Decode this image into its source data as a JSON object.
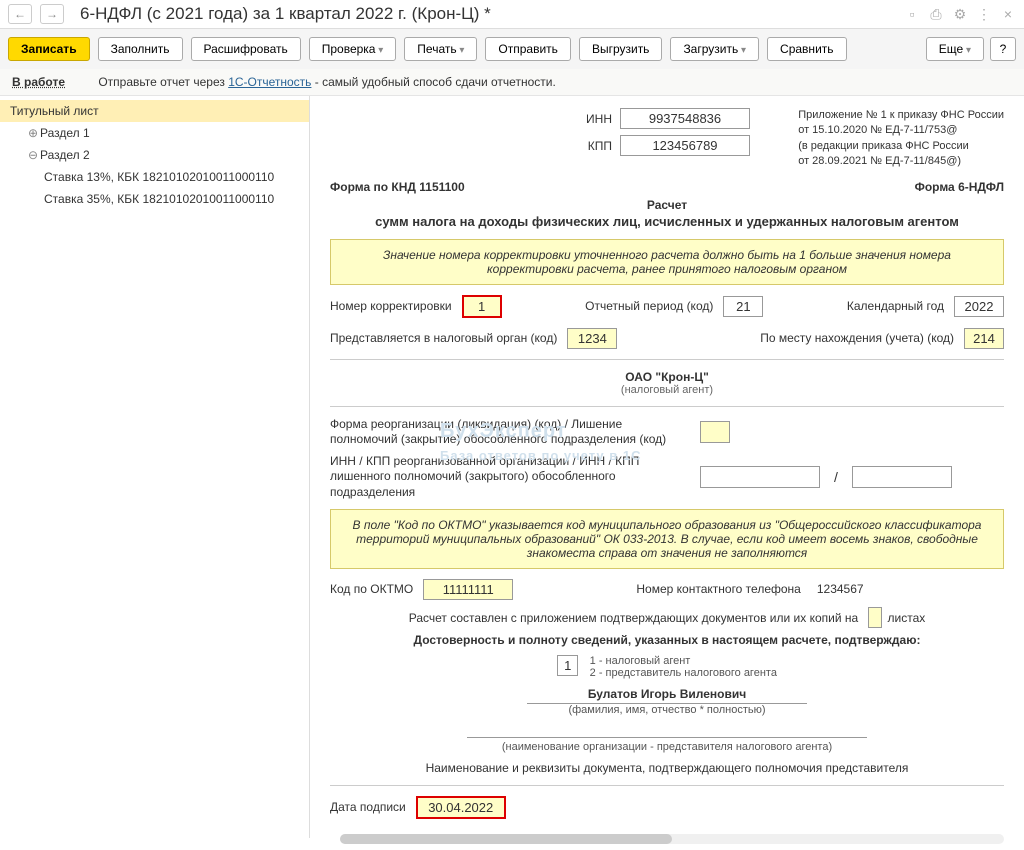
{
  "header": {
    "title": "6-НДФЛ (с 2021 года) за 1 квартал 2022 г. (Крон-Ц) *"
  },
  "toolbar": {
    "record": "Записать",
    "fill": "Заполнить",
    "decode": "Расшифровать",
    "check": "Проверка",
    "print": "Печать",
    "send": "Отправить",
    "export": "Выгрузить",
    "import": "Загрузить",
    "compare": "Сравнить",
    "more": "Еще",
    "help": "?"
  },
  "infobar": {
    "status": "В работе",
    "text1": "Отправьте отчет через ",
    "link": "1С-Отчетность",
    "text2": " - самый удобный способ сдачи отчетности."
  },
  "tree": {
    "title_page": "Титульный лист",
    "section1": "Раздел 1",
    "section2": "Раздел 2",
    "rate13": "Ставка 13%, КБК 18210102010011000110",
    "rate35": "Ставка 35%, КБК 18210102010011000110"
  },
  "form": {
    "inn_l": "ИНН",
    "inn_v": "9937548836",
    "kpp_l": "КПП",
    "kpp_v": "123456789",
    "annex1": "Приложение № 1 к приказу ФНС России",
    "annex2": "от 15.10.2020 № ЕД-7-11/753@",
    "annex3": "(в редакции приказа ФНС России",
    "annex4": "от 28.09.2021 № ЕД-7-11/845@)",
    "knd": "Форма по КНД 1151100",
    "formname": "Форма 6-НДФЛ",
    "subtitle": "Расчет",
    "subtitle2": "сумм налога на доходы физических лиц, исчисленных и удержанных налоговым агентом",
    "note1": "Значение номера корректировки уточненного расчета должно быть на 1 больше значения номера корректировки расчета, ранее принятого налоговым органом",
    "corr_l": "Номер корректировки",
    "corr_v": "1",
    "period_l": "Отчетный период (код)",
    "period_v": "21",
    "year_l": "Календарный год",
    "year_v": "2022",
    "tax_org_l": "Представляется в налоговый орган (код)",
    "tax_org_v": "1234",
    "loc_l": "По месту нахождения (учета) (код)",
    "loc_v": "214",
    "org": "ОАО \"Крон-Ц\"",
    "org_sub": "(налоговый агент)",
    "reorg_l": "Форма реорганизации (ликвидация) (код) / Лишение полномочий (закрытие) обособленного подразделения (код)",
    "reorg2_l": "ИНН / КПП реорганизованной организации / ИНН / КПП лишенного полномочий (закрытого) обособленного подразделения",
    "note2": "В поле \"Код по ОКТМО\" указывается код муниципального образования из \"Общероссийского классификатора территорий муниципальных образований\" ОК 033-2013. В случае, если код имеет восемь знаков, свободные знакоместа справа от значения не заполняются",
    "oktmo_l": "Код по ОКТМО",
    "oktmo_v": "11111111",
    "phone_l": "Номер контактного телефона",
    "phone_v": "1234567",
    "pages_l1": "Расчет составлен с приложением подтверждающих документов или их копий на",
    "pages_l2": "листах",
    "confirm": "Достоверность и полноту сведений, указанных в настоящем расчете, подтверждаю:",
    "agent_v": "1",
    "agent_opt1": "1 - налоговый агент",
    "agent_opt2": "2 - представитель налогового агента",
    "signer": "Булатов Игорь Виленович",
    "signer_sub": "(фамилия, имя, отчество * полностью)",
    "rep_sub": "(наименование организации - представителя налогового агента)",
    "doc_title": "Наименование и реквизиты документа, подтверждающего полномочия представителя",
    "date_l": "Дата подписи",
    "date_v": "30.04.2022"
  }
}
